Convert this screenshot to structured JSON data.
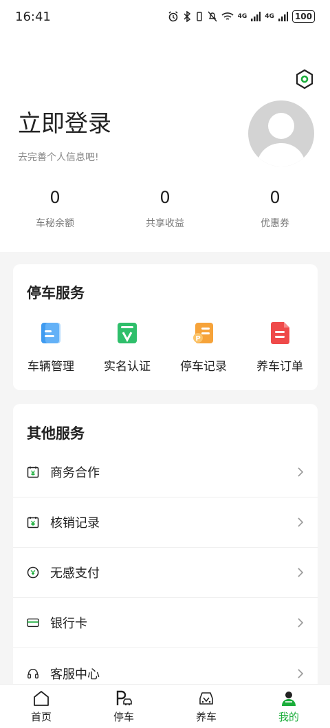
{
  "status_bar": {
    "time": "16:41",
    "network": "4G",
    "network2": "4G",
    "battery": "100"
  },
  "profile": {
    "title": "立即登录",
    "subtitle": "去完善个人信息吧!",
    "stats": [
      {
        "value": "0",
        "label": "车秘余额"
      },
      {
        "value": "0",
        "label": "共享收益"
      },
      {
        "value": "0",
        "label": "优惠券"
      }
    ]
  },
  "parking_services": {
    "title": "停车服务",
    "items": [
      {
        "label": "车辆管理",
        "icon": "vehicle-doc-icon",
        "color": "#3f9bf0"
      },
      {
        "label": "实名认证",
        "icon": "verify-v-icon",
        "color": "#2fbf6b"
      },
      {
        "label": "停车记录",
        "icon": "parking-record-icon",
        "color": "#f6a33a"
      },
      {
        "label": "养车订单",
        "icon": "order-doc-icon",
        "color": "#ef4a4a"
      }
    ]
  },
  "other_services": {
    "title": "其他服务",
    "items": [
      {
        "label": "商务合作",
        "icon": "yuan-calendar-icon"
      },
      {
        "label": "核销记录",
        "icon": "yuan-calendar-icon"
      },
      {
        "label": "无感支付",
        "icon": "auto-pay-icon"
      },
      {
        "label": "银行卡",
        "icon": "bank-card-icon"
      },
      {
        "label": "客服中心",
        "icon": "headset-icon"
      }
    ]
  },
  "tabbar": {
    "items": [
      {
        "label": "首页",
        "icon": "home-icon",
        "active": false
      },
      {
        "label": "停车",
        "icon": "parking-car-icon",
        "active": false
      },
      {
        "label": "养车",
        "icon": "car-care-icon",
        "active": false
      },
      {
        "label": "我的",
        "icon": "profile-icon",
        "active": true
      }
    ]
  },
  "colors": {
    "accent": "#1aad3a",
    "background": "#f5f5f5"
  }
}
